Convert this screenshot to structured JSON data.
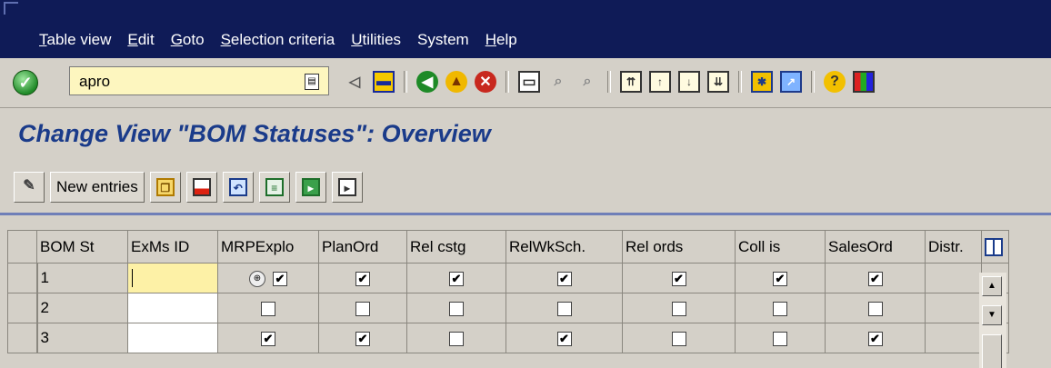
{
  "menubar": {
    "items": [
      "Table view",
      "Edit",
      "Goto",
      "Selection criteria",
      "Utilities",
      "System",
      "Help"
    ]
  },
  "toolbar": {
    "command_value": "apro",
    "icons": [
      "enter-icon",
      "command-history-icon",
      "nav-left-arrow-icon",
      "save-icon",
      "back-icon",
      "exit-icon",
      "cancel-icon",
      "print-icon",
      "find-icon",
      "find-next-icon",
      "first-page-icon",
      "previous-page-icon",
      "next-page-icon",
      "last-page-icon",
      "create-session-icon",
      "generate-shortcut-icon",
      "help-icon",
      "layout-menu-icon"
    ]
  },
  "title": "Change View \"BOM Statuses\": Overview",
  "app_toolbar": {
    "new_entries_label": "New entries",
    "icons": [
      "display-change-icon",
      "copy-as-icon",
      "delete-icon",
      "undo-change-icon",
      "select-all-icon",
      "select-block-icon",
      "deselect-all-icon"
    ]
  },
  "table": {
    "columns": [
      "BOM St",
      "ExMs ID",
      "MRPExplo",
      "PlanOrd",
      "Rel cstg",
      "RelWkSch.",
      "Rel ords",
      "Coll is",
      "SalesOrd",
      "Distr."
    ],
    "rows": [
      {
        "bom_st": "1",
        "exms_id": "",
        "mrpexplo": true,
        "planord": true,
        "rel_cstg": true,
        "relwksch": true,
        "rel_ords": true,
        "coll_is": true,
        "salesord": true
      },
      {
        "bom_st": "2",
        "exms_id": "",
        "mrpexplo": false,
        "planord": false,
        "rel_cstg": false,
        "relwksch": false,
        "rel_ords": false,
        "coll_is": false,
        "salesord": false
      },
      {
        "bom_st": "3",
        "exms_id": "",
        "mrpexplo": true,
        "planord": true,
        "rel_cstg": false,
        "relwksch": true,
        "rel_ords": false,
        "coll_is": false,
        "salesord": true
      }
    ]
  }
}
